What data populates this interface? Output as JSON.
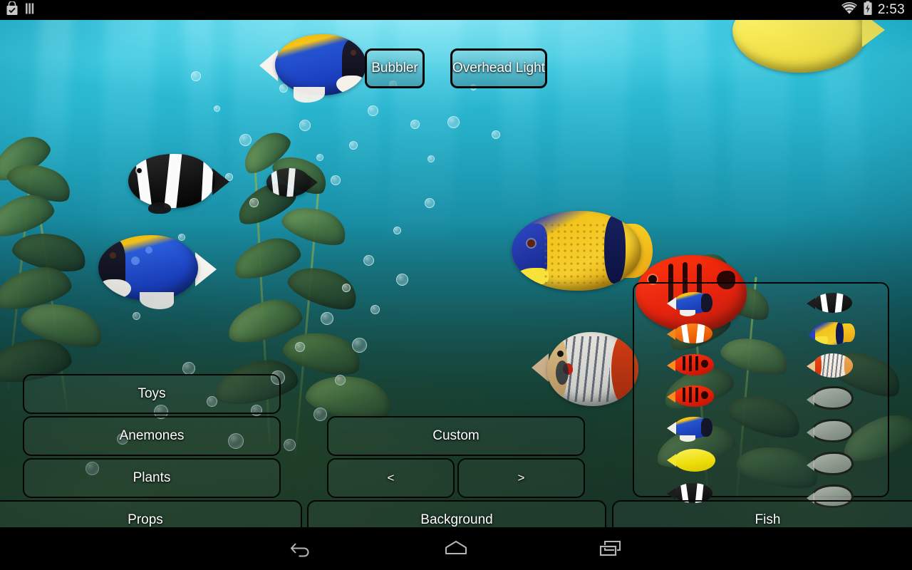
{
  "statusbar": {
    "clock": "2:53",
    "icons_left": [
      "play-store-installed-icon",
      "sim-bars-icon"
    ],
    "icons_right": [
      "wifi-icon",
      "battery-charging-icon"
    ]
  },
  "app": {
    "name": "aquarium-live-wallpaper-settings",
    "top_buttons": [
      {
        "id": "bubbler",
        "label": "Bubbler"
      },
      {
        "id": "overhead-light",
        "label": "Overhead Light"
      }
    ],
    "left_column_buttons": [
      {
        "id": "toys",
        "label": "Toys"
      },
      {
        "id": "anemones",
        "label": "Anemones"
      },
      {
        "id": "plants",
        "label": "Plants"
      }
    ],
    "center_column_buttons": [
      {
        "id": "custom",
        "label": "Custom"
      }
    ],
    "pager": {
      "prev_label": "<",
      "next_label": ">"
    },
    "bottom_tabs": [
      {
        "id": "props",
        "label": "Props"
      },
      {
        "id": "background",
        "label": "Background"
      },
      {
        "id": "fish",
        "label": "Fish"
      }
    ],
    "fish_panel": {
      "name": "fish-picker",
      "left_column": [
        {
          "id": "fish-1",
          "species": "blue-tang",
          "locked": false,
          "colors": {
            "body": "#1140c8",
            "top": "#f5c518",
            "fin": "#ffffff"
          }
        },
        {
          "id": "fish-2",
          "species": "clownfish-orange",
          "locked": false,
          "colors": {
            "body": "#f06a10",
            "stripe": "#ffffff",
            "fin": "#f7941d"
          }
        },
        {
          "id": "fish-3",
          "species": "red-squirrelfish",
          "locked": false,
          "colors": {
            "body": "#e0220f",
            "stripe": "#2a0704",
            "fin": "#ff8a22"
          }
        },
        {
          "id": "fish-4",
          "species": "red-squirrelfish",
          "locked": false,
          "colors": {
            "body": "#e0220f",
            "stripe": "#2a0704",
            "fin": "#ff8a22"
          }
        },
        {
          "id": "fish-5",
          "species": "blue-tang",
          "locked": false,
          "colors": {
            "body": "#1140c8",
            "top": "#f5c518",
            "fin": "#ffffff"
          }
        },
        {
          "id": "fish-6",
          "species": "yellow-tang",
          "locked": false,
          "colors": {
            "body": "#ecdc08",
            "fin": "#f6ea35"
          }
        },
        {
          "id": "fish-7",
          "species": "clownfish-black",
          "locked": false,
          "colors": {
            "body": "#111111",
            "stripe": "#ffffff"
          }
        }
      ],
      "right_column": [
        {
          "id": "fish-8",
          "species": "clownfish-black",
          "locked": false,
          "colors": {
            "body": "#111111",
            "stripe": "#ffffff"
          }
        },
        {
          "id": "fish-9",
          "species": "majestic-angelfish",
          "locked": false,
          "colors": {
            "body": "#f2c41a",
            "accent": "#1d3fbb",
            "fin": "#2a56d6"
          }
        },
        {
          "id": "fish-10",
          "species": "butterflyfish",
          "locked": false,
          "colors": {
            "body": "#f4f2ee",
            "accent": "#e04214",
            "stripe": "#6d7480"
          }
        },
        {
          "id": "fish-11",
          "species": "locked-slot",
          "locked": true
        },
        {
          "id": "fish-12",
          "species": "locked-slot",
          "locked": true
        },
        {
          "id": "fish-13",
          "species": "locked-slot",
          "locked": true
        },
        {
          "id": "fish-14",
          "species": "locked-slot",
          "locked": true
        }
      ]
    },
    "scene_fish": [
      {
        "id": "scene-tang-top",
        "species": "powder-blue-tang"
      },
      {
        "id": "scene-clown-black",
        "species": "black-clownfish"
      },
      {
        "id": "scene-clown-black-small",
        "species": "black-clownfish"
      },
      {
        "id": "scene-tang-left",
        "species": "powder-blue-tang"
      },
      {
        "id": "scene-angelfish",
        "species": "majestic-angelfish"
      },
      {
        "id": "scene-butterflyfish",
        "species": "butterflyfish"
      },
      {
        "id": "scene-yellow-top",
        "species": "yellow-tang"
      },
      {
        "id": "scene-red-big",
        "species": "red-squirrelfish"
      }
    ]
  },
  "navbar": {
    "buttons": [
      {
        "id": "back",
        "icon": "back-arrow-icon"
      },
      {
        "id": "home",
        "icon": "home-icon"
      },
      {
        "id": "recents",
        "icon": "recent-apps-icon"
      }
    ]
  },
  "colors": {
    "water_top": "#2fc2da",
    "water_bottom": "#06313a",
    "button_border": "#050505",
    "button_text": "#ffffff",
    "statusbar_bg": "#000000",
    "top_button_fill": "#5fa9b9"
  }
}
